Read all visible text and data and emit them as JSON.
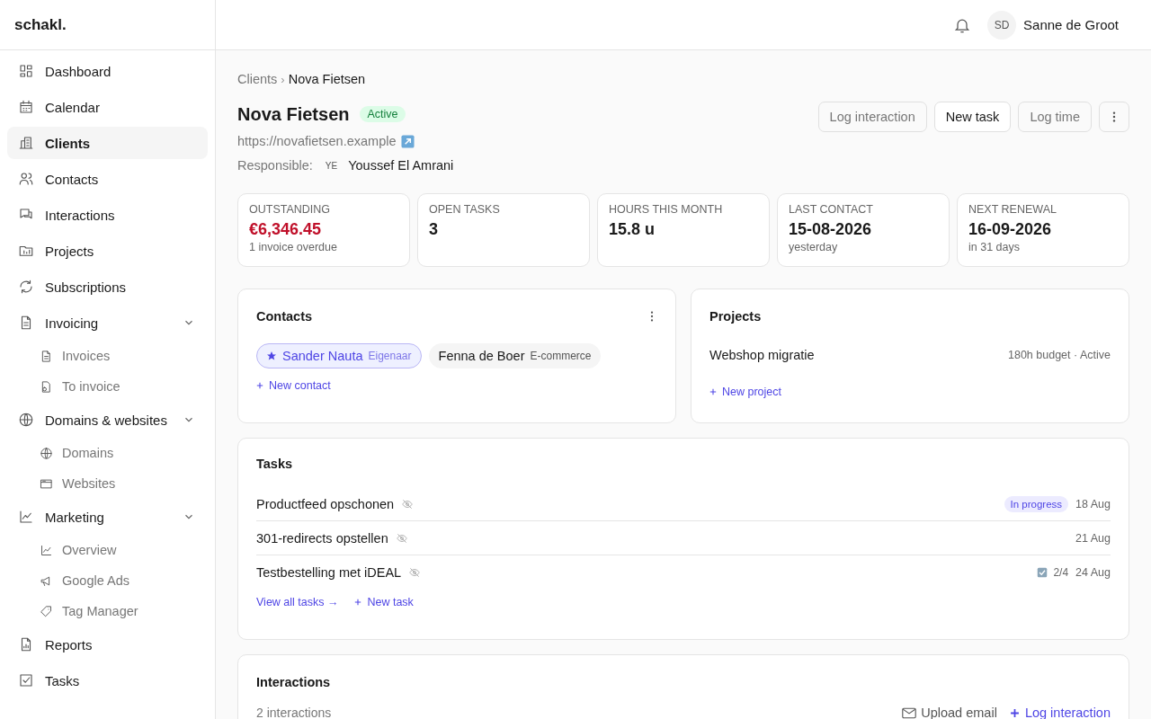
{
  "brand": "schakl.",
  "sidebar": {
    "items": [
      {
        "label": "Dashboard",
        "selected": false
      },
      {
        "label": "Calendar",
        "selected": false
      },
      {
        "label": "Clients",
        "selected": true
      },
      {
        "label": "Contacts",
        "selected": false
      },
      {
        "label": "Interactions",
        "selected": false
      },
      {
        "label": "Projects",
        "selected": false
      },
      {
        "label": "Subscriptions",
        "selected": false
      },
      {
        "label": "Invoicing",
        "selected": false,
        "expanded": true,
        "children": [
          {
            "label": "Invoices",
            "selected": false
          },
          {
            "label": "To invoice",
            "selected": false
          }
        ]
      },
      {
        "label": "Domains & websites",
        "selected": false,
        "expanded": true,
        "children": [
          {
            "label": "Domains",
            "selected": false
          },
          {
            "label": "Websites",
            "selected": false
          }
        ]
      },
      {
        "label": "Marketing",
        "selected": false,
        "expanded": true,
        "children": [
          {
            "label": "Overview",
            "selected": false
          },
          {
            "label": "Google Ads",
            "selected": false
          },
          {
            "label": "Tag Manager",
            "selected": false
          }
        ]
      },
      {
        "label": "Reports",
        "selected": false
      },
      {
        "label": "Tasks",
        "selected": false
      }
    ]
  },
  "header": {
    "user": {
      "initials": "SD",
      "name": "Sanne de Groot"
    }
  },
  "breadcrumb": {
    "separator": "›",
    "items": [
      {
        "label": "Clients",
        "current": false
      },
      {
        "label": "Nova Fietsen",
        "current": true
      }
    ]
  },
  "client": {
    "name": "Nova Fietsen",
    "status": "Active",
    "url": "https://novafietsen.example",
    "responsible_label": "Responsible:",
    "responsible": {
      "initials": "YE",
      "name": "Youssef El Amrani"
    }
  },
  "actions": [
    {
      "kind": "secondary",
      "label": "Log interaction"
    },
    {
      "kind": "primary",
      "label": "New task"
    },
    {
      "kind": "secondary",
      "label": "Log time"
    },
    {
      "kind": "more"
    }
  ],
  "stats": [
    {
      "label": "OUTSTANDING",
      "value": "€6,346.45",
      "note": "1 invoice overdue",
      "alert": true
    },
    {
      "label": "OPEN TASKS",
      "value": "3",
      "alert": false
    },
    {
      "label": "HOURS THIS MONTH",
      "value": "15.8 u",
      "alert": false
    },
    {
      "label": "LAST CONTACT",
      "value": "15-08-2026",
      "note": "yesterday",
      "alert": false
    },
    {
      "label": "NEXT RENEWAL",
      "value": "16-09-2026",
      "note": "in 31 days",
      "alert": false
    }
  ],
  "contacts": {
    "title": "Contacts",
    "items": [
      {
        "name": "Sander Nauta",
        "role": "Eigenaar",
        "primary": true
      },
      {
        "name": "Fenna de Boer",
        "role": "E-commerce",
        "primary": false
      }
    ],
    "add_label": "New contact"
  },
  "projects": {
    "title": "Projects",
    "items": [
      {
        "name": "Webshop migratie",
        "meta": "180h budget · Active"
      }
    ],
    "add_label": "New project"
  },
  "tasks": {
    "title": "Tasks",
    "items": [
      {
        "title": "Productfeed opschonen",
        "status": "In progress",
        "date": "18 Aug"
      },
      {
        "title": "301-redirects opstellen",
        "date": "21 Aug"
      },
      {
        "title": "Testbestelling met iDEAL",
        "checklist": "2/4",
        "date": "24 Aug"
      }
    ],
    "view_all": "View all tasks →",
    "add_label": "New task"
  },
  "interactions": {
    "title": "Interactions",
    "count": "2 interactions",
    "upload_label": "Upload email",
    "log_label": "Log interaction"
  }
}
